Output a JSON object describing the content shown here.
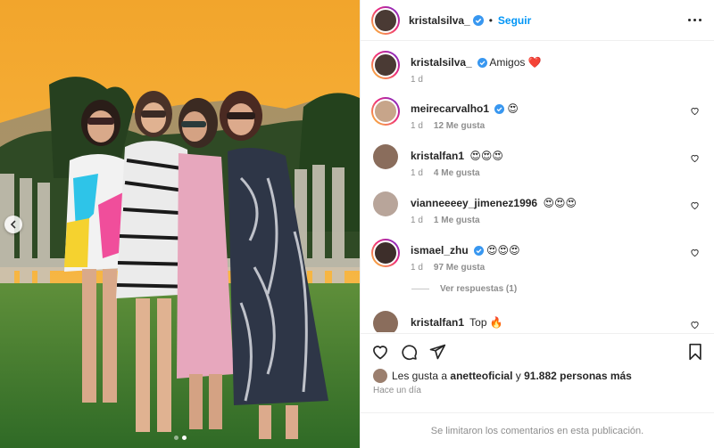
{
  "post": {
    "author": "kristalsilva_",
    "follow_label": "Seguir",
    "separator": "•",
    "caption_text": "Amigos",
    "caption_emoji": "❤️",
    "caption_time": "1 d"
  },
  "comments": [
    {
      "user": "meirecarvalho1",
      "verified": true,
      "text": "😍",
      "time": "1 d",
      "likes": "12 Me gusta",
      "avatar_color": "#c7a58a",
      "ring": true
    },
    {
      "user": "kristalfan1",
      "verified": false,
      "text": "😍😍😍",
      "time": "1 d",
      "likes": "4 Me gusta",
      "avatar_color": "#8a6d5c",
      "ring": false
    },
    {
      "user": "vianneeeey_jimenez1996",
      "verified": false,
      "text": "😍😍😍",
      "time": "1 d",
      "likes": "1 Me gusta",
      "avatar_color": "#b8a59a",
      "ring": false
    },
    {
      "user": "ismael_zhu",
      "verified": true,
      "text": "😍😍😍",
      "time": "1 d",
      "likes": "97 Me gusta",
      "avatar_color": "#3d2e2a",
      "ring": true
    },
    {
      "user": "kristalfan1",
      "verified": false,
      "text": "Top 🔥",
      "time": "",
      "likes": "",
      "avatar_color": "#8a6d5c",
      "ring": false
    }
  ],
  "replies_label": "Ver respuestas (1)",
  "likes_line": {
    "prefix": "Les gusta a",
    "user": "anetteoficial",
    "middle": "y",
    "count": "91.882 personas más"
  },
  "post_time": "Hace un día",
  "comments_disabled": "Se limitaron los comentarios en esta publicación.",
  "colors": {
    "accent": "#0095f6",
    "verified": "#3897f0",
    "muted": "#8e8e8e",
    "heart": "#ed4956"
  },
  "icons": [
    "chevron-left-icon",
    "more-options-icon",
    "verified-icon",
    "heart-icon",
    "comment-icon",
    "share-icon",
    "bookmark-icon"
  ],
  "carousel": {
    "slides": 2,
    "active_index": 1
  }
}
